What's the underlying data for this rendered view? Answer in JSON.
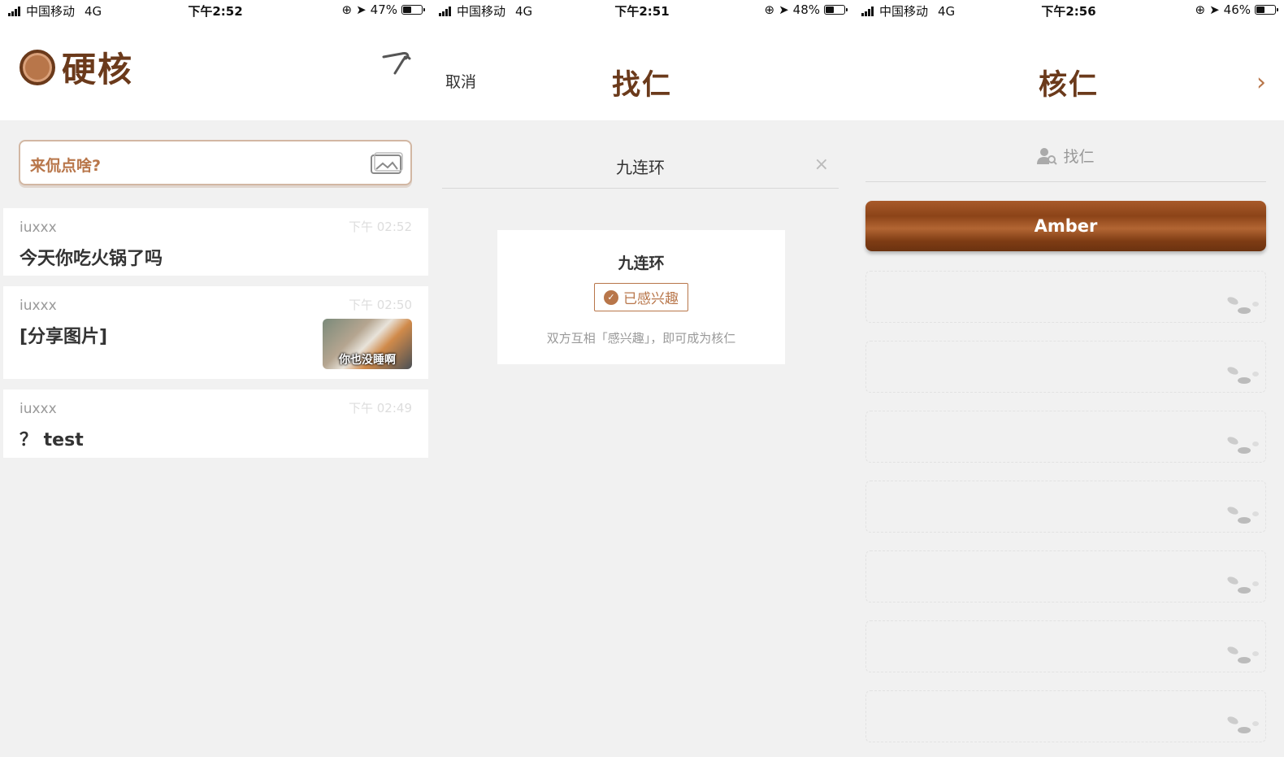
{
  "screens": [
    {
      "status": {
        "carrier": "中国移动",
        "network": "4G",
        "time": "下午2:52",
        "battery": "47%",
        "battery_level": 0.47
      },
      "app_title": "硬核",
      "compose_placeholder": "来侃点啥?",
      "posts": [
        {
          "author": "iuxxx",
          "time": "下午 02:52",
          "content": "今天你吃火锅了吗"
        },
        {
          "author": "iuxxx",
          "time": "下午 02:50",
          "content": "[分享图片]",
          "thumb_caption": "你也没睡啊"
        },
        {
          "author": "iuxxx",
          "time": "下午 02:49",
          "content": "？ test"
        }
      ]
    },
    {
      "status": {
        "carrier": "中国移动",
        "network": "4G",
        "time": "下午2:51",
        "battery": "48%",
        "battery_level": 0.48
      },
      "cancel_label": "取消",
      "title": "找仁",
      "search_value": "九连环",
      "clear_icon": "×",
      "card": {
        "name": "九连环",
        "badge_label": "已感兴趣",
        "hint": "双方互相「感兴趣」，即可成为核仁"
      }
    },
    {
      "status": {
        "carrier": "中国移动",
        "network": "4G",
        "time": "下午2:56",
        "battery": "46%",
        "battery_level": 0.46
      },
      "title": "核仁",
      "next_icon": "›",
      "find_label": "找仁",
      "friends": [
        "Amber"
      ],
      "empty_slot_count": 7
    }
  ],
  "colors": {
    "brand_brown": "#6b3a1b",
    "accent": "#b8764a",
    "background": "#f1f1f1"
  },
  "icons": [
    "nutcracker-icon",
    "image-icon",
    "check-icon",
    "person-search-icon",
    "chevron-right-icon",
    "nuts-icon",
    "close-icon"
  ]
}
